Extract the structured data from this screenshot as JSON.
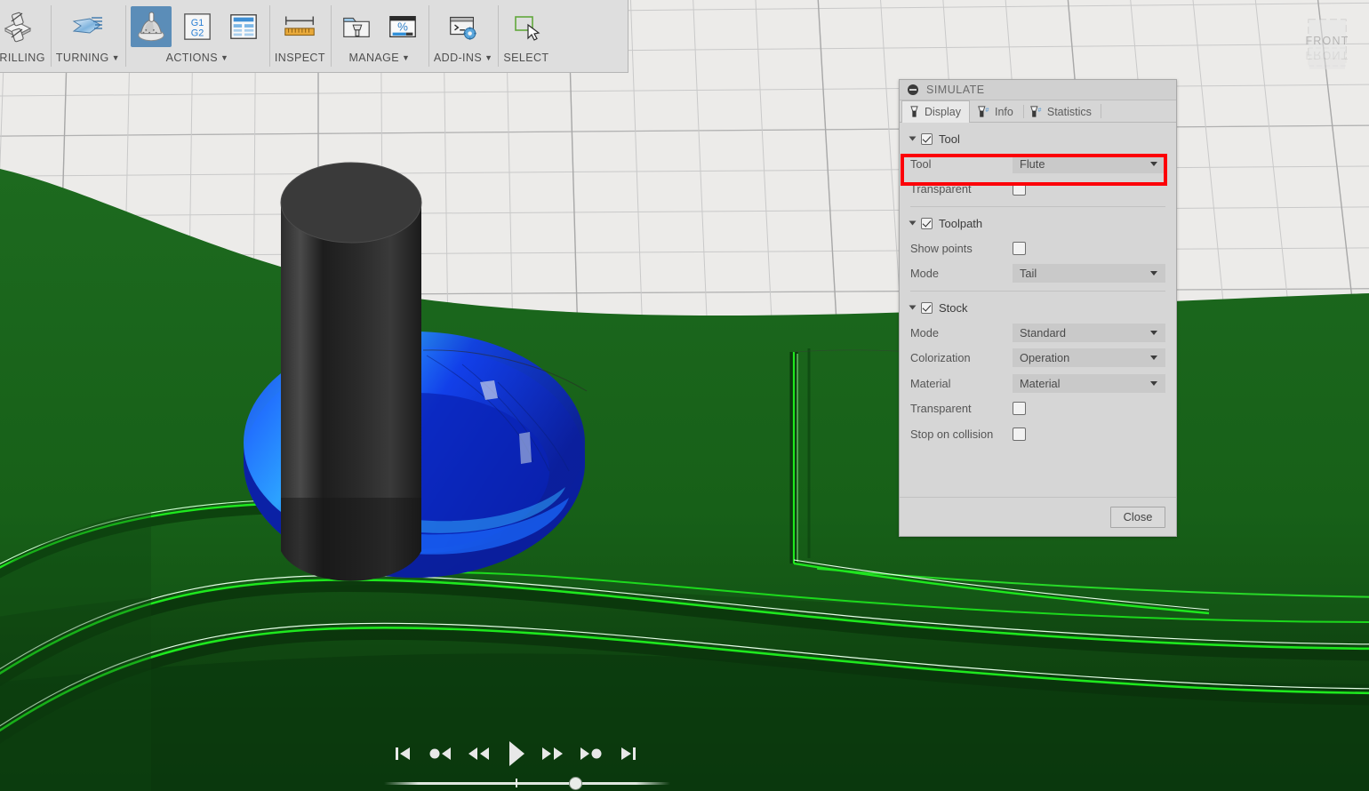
{
  "app": {
    "viewcube_label": "FRONT"
  },
  "toolbar": {
    "groups": [
      {
        "label": "DRILLING",
        "has_caret": false,
        "icons": [
          "drilling-icon"
        ]
      },
      {
        "label": "TURNING",
        "has_caret": true,
        "icons": [
          "turning-icon"
        ]
      },
      {
        "label": "ACTIONS",
        "has_caret": true,
        "icons": [
          "simulate-icon",
          "g1g2-post-process-icon",
          "setup-sheet-icon"
        ]
      },
      {
        "label": "INSPECT",
        "has_caret": false,
        "icons": [
          "measure-ruler-icon"
        ]
      },
      {
        "label": "MANAGE",
        "has_caret": true,
        "icons": [
          "tool-library-icon",
          "machining-time-icon"
        ]
      },
      {
        "label": "ADD-INS",
        "has_caret": true,
        "icons": [
          "scripts-addins-icon"
        ]
      },
      {
        "label": "SELECT",
        "has_caret": false,
        "icons": [
          "select-cursor-icon"
        ]
      }
    ]
  },
  "dialog": {
    "title": "SIMULATE",
    "tabs": [
      {
        "label": "Display",
        "icon": "tool-display-icon",
        "active": true
      },
      {
        "label": "Info",
        "icon": "tool-info-icon",
        "active": false
      },
      {
        "label": "Statistics",
        "icon": "tool-statistics-icon",
        "active": false
      }
    ],
    "sections": [
      {
        "name": "tool",
        "label": "Tool",
        "checked": true,
        "rows": [
          {
            "type": "dropdown",
            "label": "Tool",
            "value": "Flute",
            "highlighted": true
          },
          {
            "type": "checkbox",
            "label": "Transparent",
            "checked": false
          }
        ]
      },
      {
        "name": "toolpath",
        "label": "Toolpath",
        "checked": true,
        "rows": [
          {
            "type": "checkbox",
            "label": "Show points",
            "checked": false
          },
          {
            "type": "dropdown",
            "label": "Mode",
            "value": "Tail",
            "highlighted": false
          }
        ]
      },
      {
        "name": "stock",
        "label": "Stock",
        "checked": true,
        "rows": [
          {
            "type": "dropdown",
            "label": "Mode",
            "value": "Standard",
            "highlighted": false
          },
          {
            "type": "dropdown",
            "label": "Colorization",
            "value": "Operation",
            "highlighted": false
          },
          {
            "type": "dropdown",
            "label": "Material",
            "value": "Material",
            "highlighted": false
          },
          {
            "type": "checkbox",
            "label": "Transparent",
            "checked": false
          },
          {
            "type": "checkbox",
            "label": "Stop on collision",
            "checked": false
          }
        ]
      }
    ],
    "close_label": "Close",
    "highlight_color": "#fc0008"
  },
  "playback": {
    "buttons": [
      {
        "name": "skip-to-start-button",
        "icon": "skip-to-start-icon"
      },
      {
        "name": "step-back-point-button",
        "icon": "step-back-point-icon"
      },
      {
        "name": "rewind-button",
        "icon": "rewind-icon"
      },
      {
        "name": "play-button",
        "icon": "play-icon"
      },
      {
        "name": "fast-forward-button",
        "icon": "fast-forward-icon"
      },
      {
        "name": "step-forward-point-button",
        "icon": "step-forward-point-icon"
      },
      {
        "name": "skip-to-end-button",
        "icon": "skip-to-end-icon"
      }
    ],
    "progress_percent": 67
  },
  "scene": {
    "colors": {
      "background": "#ecebe9",
      "grid_line": "#b9b9b9",
      "stock_green": "#18561a",
      "stock_green_dark": "#0c3d0e",
      "toolpath_green": "#22e022",
      "pocket_blue": "#0a2fe0",
      "tool_dark": "#383838"
    }
  }
}
